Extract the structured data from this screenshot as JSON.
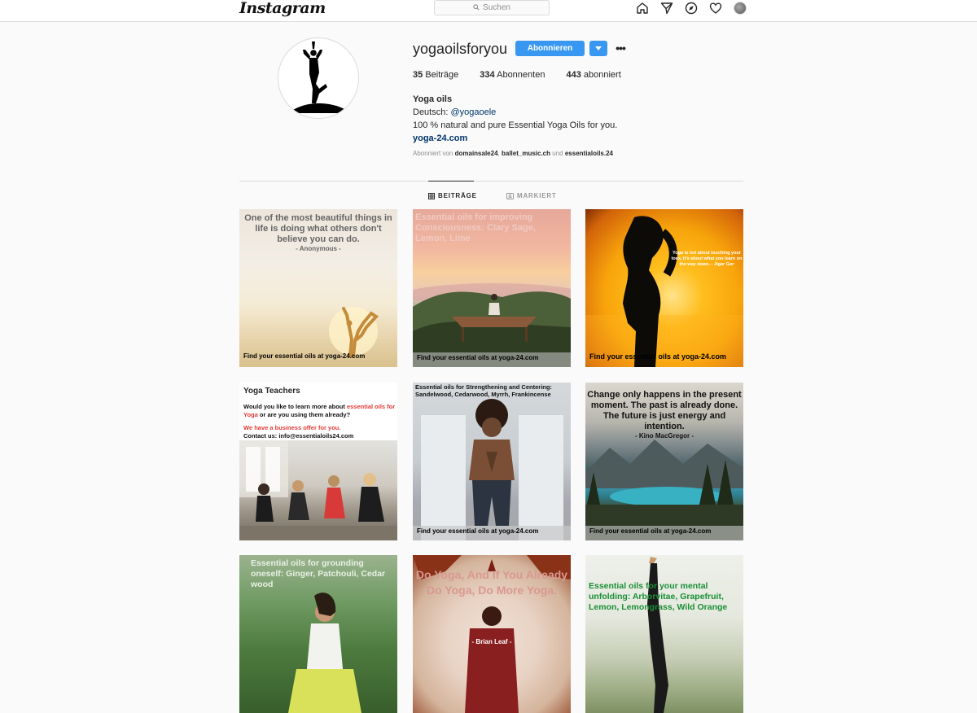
{
  "nav": {
    "logo": "Instagram",
    "search_placeholder": "Suchen",
    "icons": [
      "home-icon",
      "direct-icon",
      "explore-icon",
      "activity-icon",
      "profile-avatar"
    ]
  },
  "profile": {
    "username": "yogaoilsforyou",
    "follow_label": "Abonnieren",
    "stats": {
      "posts_count": "35",
      "posts_label": "Beiträge",
      "followers_count": "334",
      "followers_label": "Abonnenten",
      "following_count": "443",
      "following_label": "abonniert"
    },
    "bio": {
      "name": "Yoga oils",
      "line1_prefix": "Deutsch:",
      "line1_mention": "@yogaoele",
      "line2": "100 % natural and pure Essential Yoga Oils for you.",
      "link": "yoga-24.com"
    },
    "followed_by": {
      "prefix": "Abonniert von",
      "user1": "domainsale24",
      "user2": "ballet_music.ch",
      "joiner": "und",
      "user3": "essentialoils.24"
    }
  },
  "tabs": [
    {
      "label": "BEITRÄGE",
      "active": true
    },
    {
      "label": "MARKIERT",
      "active": false
    }
  ],
  "posts": {
    "p1": {
      "quote": "One of the most beautiful things in life is doing what others don't believe you can do.",
      "author": "- Anonymous -",
      "caption": "Find your essential oils at yoga-24.com"
    },
    "p2": {
      "quote": "Essential oils for improving Consciousness: Clary Sage, Lemon, Lime",
      "caption": "Find your essential oils at yoga-24.com"
    },
    "p3": {
      "quote": "Yoga is not about touching your toes, it's about what you learn on the way down.",
      "author": "- Jigar Gor",
      "caption": "Find your essential oils at yoga-24.com"
    },
    "p4": {
      "heading": "Yoga Teachers",
      "text_a": "Would you like to learn more about",
      "text_red": "essential oils for Yoga",
      "text_b": "or are you using them already?",
      "offer": "We have a business offer for you.",
      "contact": "Contact us: info@essentialoils24.com"
    },
    "p5": {
      "quote": "Essential oils for Strengthening and Centering: Sandelwood, Cedarwood, Myrrh, Frankincense",
      "caption": "Find your essential oils at yoga-24.com"
    },
    "p6": {
      "quote": "Change only happens in the present moment. The past is already done. The future is just energy and intention.",
      "author": "- Kino MacGregor -",
      "caption": "Find your essential oils at yoga-24.com"
    },
    "p7": {
      "quote": "Essential oils for grounding oneself: Ginger, Patchouli, Cedar wood"
    },
    "p8": {
      "quote": "Do Yoga, And If You Already Do Yoga, Do More Yoga.",
      "author": "- Brian Leaf -"
    },
    "p9": {
      "quote": "Essential oils for your mental unfolding: Arborvitae, Grapefruit, Lemon, Lemongrass, Wild Orange"
    }
  },
  "colors": {
    "accent": "#3897f0",
    "link": "#003569",
    "muted": "#8e8e8e",
    "red_text": "#e53935",
    "green_text": "#1a8f36"
  }
}
